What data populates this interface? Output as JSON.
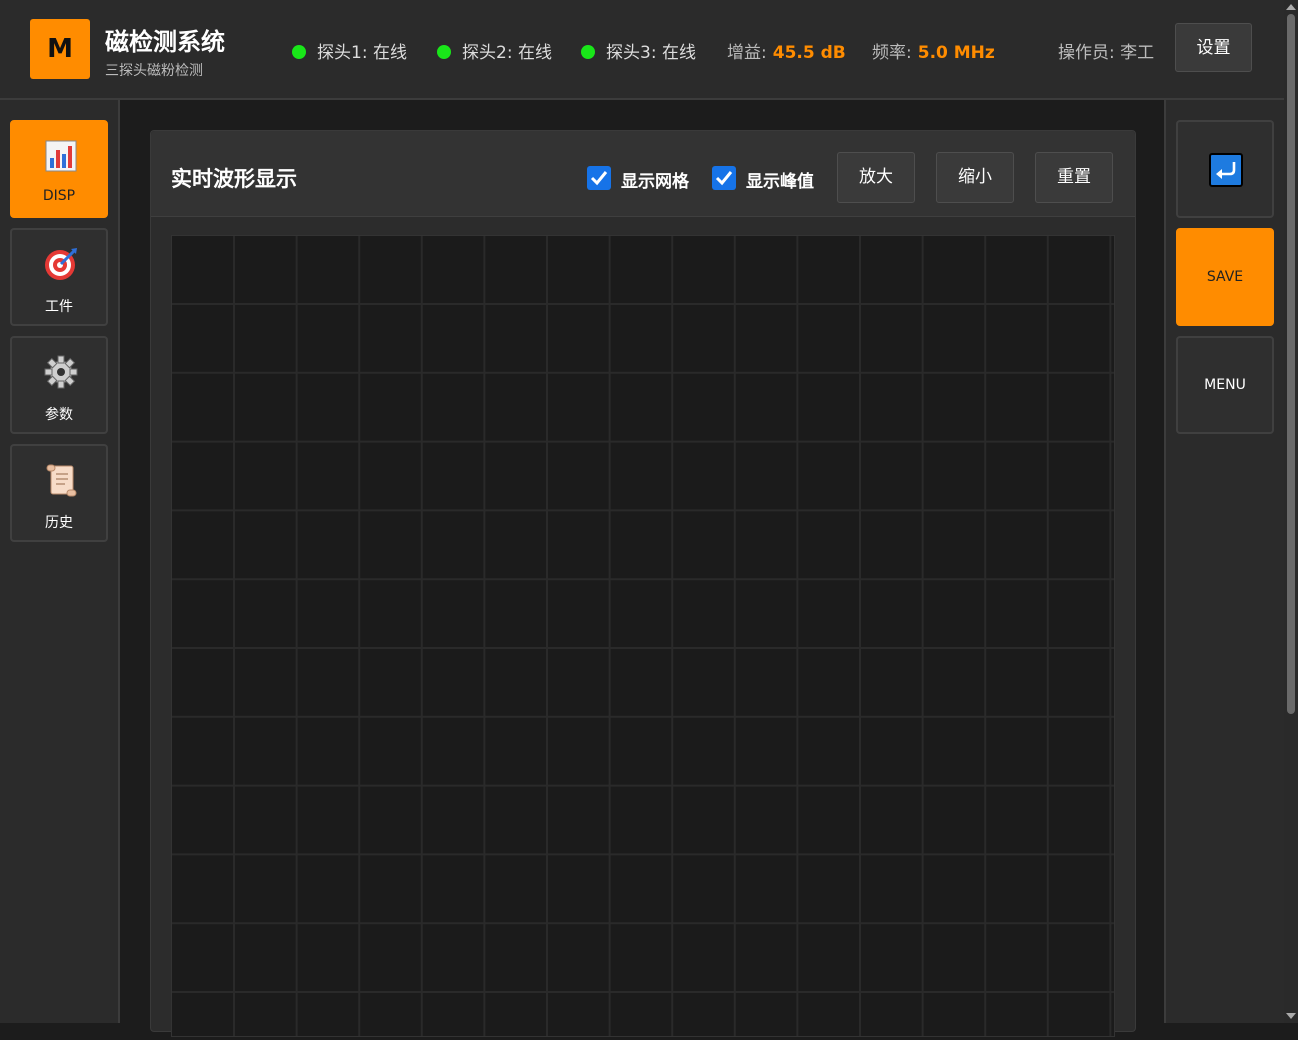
{
  "header": {
    "logo_letter": "M",
    "title": "磁检测系统",
    "subtitle": "三探头磁粉检测",
    "probes": [
      {
        "label": "探头1: 在线",
        "status_color": "#19e619"
      },
      {
        "label": "探头2: 在线",
        "status_color": "#19e619"
      },
      {
        "label": "探头3: 在线",
        "status_color": "#19e619"
      }
    ],
    "gain_label": "增益:",
    "gain_value": "45.5 dB",
    "freq_label": "频率:",
    "freq_value": "5.0 MHz",
    "operator": "操作员: 李工",
    "settings_label": "设置"
  },
  "sidebar": {
    "items": [
      {
        "label": "DISP",
        "icon": "chart-icon",
        "active": true
      },
      {
        "label": "工件",
        "icon": "target-icon",
        "active": false
      },
      {
        "label": "参数",
        "icon": "gear-icon",
        "active": false
      },
      {
        "label": "历史",
        "icon": "scroll-icon",
        "active": false
      }
    ]
  },
  "right_sidebar": {
    "items": [
      {
        "label": "",
        "icon": "return-icon"
      },
      {
        "label": "SAVE",
        "icon": ""
      },
      {
        "label": "MENU",
        "icon": ""
      }
    ]
  },
  "panel": {
    "title": "实时波形显示",
    "show_grid_label": "显示网格",
    "show_grid_checked": true,
    "show_peak_label": "显示峰值",
    "show_peak_checked": true,
    "zoom_in_label": "放大",
    "zoom_out_label": "缩小",
    "reset_label": "重置"
  },
  "colors": {
    "accent": "#ff8c00",
    "online": "#19e619",
    "checkbox": "#1673e8",
    "background": "#1c1c1c",
    "grid_line": "#2a2a2a"
  }
}
